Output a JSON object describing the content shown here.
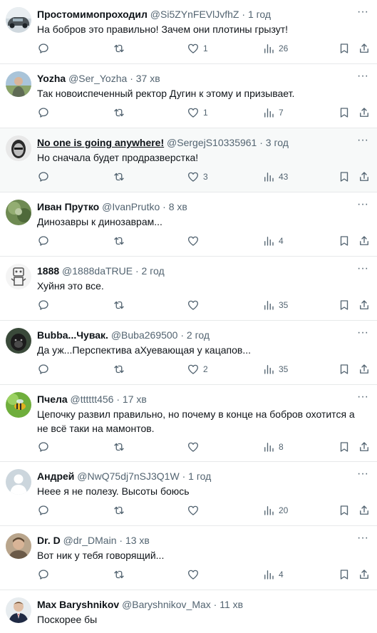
{
  "tweets": [
    {
      "name": "Простомимопроходил",
      "handle": "@Si5ZYnFEVlJvfhZ",
      "time": "1 год",
      "text": "На бобров это правильно! Зачем они плотины грызут!",
      "likes": "1",
      "views": "26",
      "avatar": "car"
    },
    {
      "name": "Yozha",
      "handle": "@Ser_Yozha",
      "time": "37 хв",
      "text": "Так новоиспеченный ректор Дугин к этому и призывает.",
      "likes": "1",
      "views": "7",
      "avatar": "person-outdoor"
    },
    {
      "name": "No one is going anywhere!",
      "handle": "@SergejS10335961",
      "time": "3 год",
      "text": "Но сначала будет продразверстка!",
      "likes": "3",
      "views": "43",
      "avatar": "bw-face"
    },
    {
      "name": "Иван Прутко",
      "handle": "@IvanPrutko",
      "time": "8 хв",
      "text": "Динозавры к динозаврам...",
      "likes": "",
      "views": "4",
      "avatar": "green-photo"
    },
    {
      "name": "1888",
      "handle": "@1888daTRUE",
      "time": "2 год",
      "text": "Хуйня это все.",
      "likes": "",
      "views": "35",
      "avatar": "robot"
    },
    {
      "name": "Bubba...Чувак.",
      "handle": "@Buba269500",
      "time": "2 год",
      "text": "Да уж...Перспектива аХуевающая у кацапов...",
      "likes": "2",
      "views": "35",
      "avatar": "gorilla"
    },
    {
      "name": "Пчела",
      "handle": "@tttttt456",
      "time": "17 хв",
      "text": "Цепочку развил правильно, но почему в конце на бобров охотится а не всё таки на мамонтов.",
      "likes": "",
      "views": "8",
      "avatar": "bee"
    },
    {
      "name": "Андрей",
      "handle": "@NwQ75dj7nSJ3Q1W",
      "time": "1 год",
      "text": "Неее я не полезу. Высоты боюсь",
      "likes": "",
      "views": "20",
      "avatar": "default"
    },
    {
      "name": "Dr. D",
      "handle": "@dr_DMain",
      "time": "13 хв",
      "text": "Вот ник у тебя говорящий...",
      "likes": "",
      "views": "4",
      "avatar": "man-photo"
    },
    {
      "name": "Max Baryshnikov",
      "handle": "@Baryshnikov_Max",
      "time": "11 хв",
      "text": "Поскорее бы",
      "likes": "",
      "views": "",
      "avatar": "suit"
    }
  ],
  "icons": {
    "reply": "reply-icon",
    "retweet": "retweet-icon",
    "like": "heart-icon",
    "views": "views-icon",
    "bookmark": "bookmark-icon",
    "share": "share-icon",
    "more": "more-icon"
  },
  "colors": {
    "text": "#0f1419",
    "secondary": "#536471",
    "divider": "#e7e9ea",
    "highlight_bg": "#f7f9f9"
  }
}
